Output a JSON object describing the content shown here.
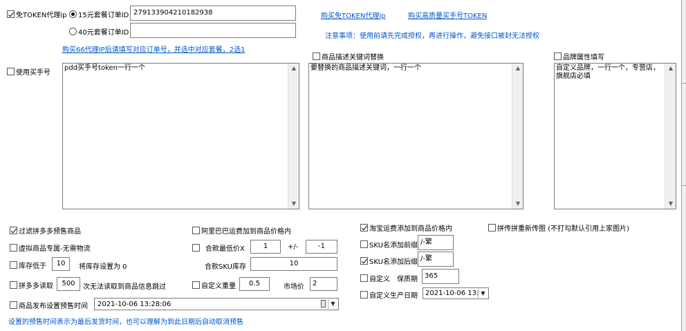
{
  "proxy": {
    "free_token_proxy_label": "免TOKEN代理ip",
    "free_token_proxy_checked": true,
    "plan15_label": "15元套餐订单ID",
    "plan15_selected": true,
    "plan15_value": "279133904210182938",
    "plan40_label": "40元套餐订单ID",
    "plan40_selected": false,
    "plan40_value": "",
    "buy_proxy_link": "购买免TOKEN代理ip",
    "buy_token_link": "购买高质量买手号TOKEN",
    "notice": "注意事项：使用前请先完成授权，再进行操作，避免接口被封无法授权",
    "buy66_link": "购买66代理IP后请填写对应订单号，并选中对应套餐，2选1"
  },
  "buyer": {
    "use_buyer_label": "使用买手号",
    "use_buyer_checked": false,
    "buyer_text": "pdd买手号token一行一个"
  },
  "replace": {
    "label": "商品描述关键词替换",
    "checked": false,
    "text": "要替换的商品描述关键词，一行一个"
  },
  "brand": {
    "label": "品牌属性填写",
    "checked": false,
    "text": "自定义品牌，一行一个，专营店，旗舰店必填"
  },
  "options": {
    "filter_presale_label": "过滤拼多多预售商品",
    "filter_presale_checked": true,
    "virtual_label": "虚拟商品专属-无需物流",
    "virtual_checked": false,
    "low_stock_label": "库存低于",
    "low_stock_checked": false,
    "low_stock_value": "10",
    "low_stock_suffix": "将库存设置为 0",
    "pdd_read_label": "拼多多读取",
    "pdd_read_checked": false,
    "pdd_read_value": "500",
    "pdd_read_suffix": "次无法读取到商品信息跳过",
    "presale_time_label": "商品发布设置预售时间",
    "presale_time_checked": false,
    "presale_time_value": "2021-10-06 13:28:06",
    "presale_hint": "设置的预售时间表示为最后发货时间，也可以理解为到此日期后自动取消预售",
    "alibaba_freight_label": "阿里巴巴运费加到商品价格内",
    "alibaba_freight_checked": false,
    "merge_min_label": "合款最低价X",
    "merge_min_checked": false,
    "merge_min_value": "1",
    "plus_minus": "+/-",
    "plus_minus_value": "-1",
    "merge_sku_label": "合款SKU库存",
    "merge_sku_value": "10",
    "custom_weight_label": "自定义重量",
    "custom_weight_checked": false,
    "custom_weight_value": "0.5",
    "market_price_label": "市场价",
    "market_price_value": "2",
    "taobao_freight_label": "淘宝运费添加到商品价格内",
    "taobao_freight_checked": true,
    "sku_prefix_label": "SKU名添加前缀",
    "sku_prefix_checked": false,
    "sku_prefix_value": "/-繁",
    "sku_suffix_label": "SKU名添加后缀",
    "sku_suffix_checked": true,
    "sku_suffix_value": "/-繁",
    "custom_shelf_label": "自定义",
    "custom_shelf_checked": false,
    "shelf_life_label": "保质期",
    "shelf_life_value": "365",
    "custom_prod_date_label": "自定义生产日期",
    "custom_prod_date_checked": false,
    "prod_date_value": "2021-10-06 13:",
    "repost_label": "拼传拼重新传图 (不打勾默认引用上家图片)",
    "repost_checked": false
  },
  "colors": {
    "link": "#0055cc",
    "border": "#7a7a7a",
    "background": "#f0f0f0"
  }
}
